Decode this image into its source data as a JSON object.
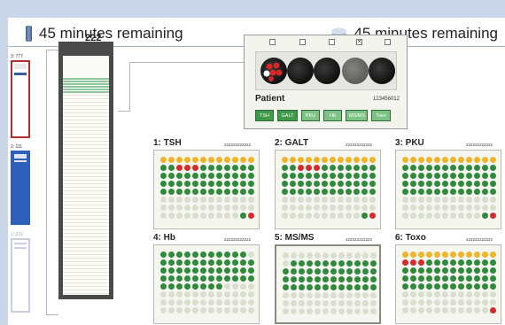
{
  "header": {
    "left_timer": "45 minutes remaining",
    "right_timer": "45 minutes remaining",
    "left_icon": "vial-icon",
    "right_icon": "stack-icon"
  },
  "racks": [
    {
      "label": "3: 777",
      "color": "#b03030",
      "accent": "#3a5aa0"
    },
    {
      "label": "2: 111",
      "color": "#2f5fb8"
    },
    {
      "label": "1: 222",
      "color": "#c7cfe0"
    }
  ],
  "main_rack": {
    "label": "222"
  },
  "patient": {
    "name": "Patient",
    "id": "123456012",
    "checkboxes": [
      "",
      "",
      "",
      "×",
      ""
    ],
    "tests": [
      "TSH",
      "GALT",
      "PKU",
      "Hb",
      "MS/MS",
      "Toxo"
    ]
  },
  "plates": [
    {
      "title": "1: TSH",
      "plate_id": "222222222222"
    },
    {
      "title": "2: GALT",
      "plate_id": "222222222222"
    },
    {
      "title": "3: PKU",
      "plate_id": "222222222222"
    },
    {
      "title": "4: Hb",
      "plate_id": "222222222222"
    },
    {
      "title": "5: MS/MS",
      "plate_id": "222222222222"
    },
    {
      "title": "6: Toxo",
      "plate_id": "222222222222"
    }
  ],
  "colors": {
    "well_empty": "#d9dfcf",
    "well_green": "#2f8a3c",
    "well_yellow": "#f0b428",
    "well_red": "#d42a2a",
    "button_green": "#3c9a48",
    "button_green_light": "#7cc285"
  }
}
